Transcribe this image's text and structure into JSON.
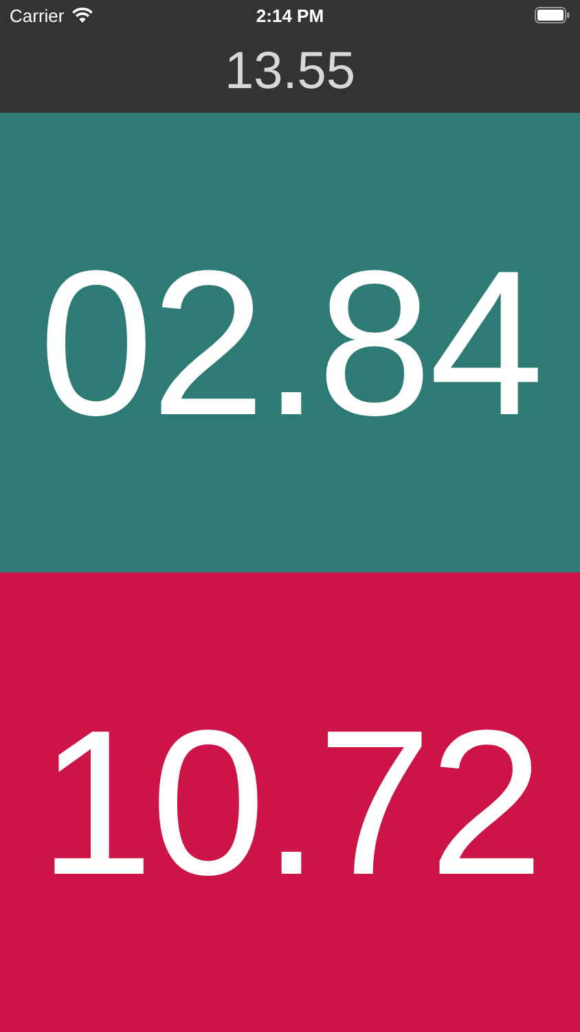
{
  "status_bar": {
    "carrier": "Carrier",
    "time": "2:14 PM"
  },
  "header": {
    "total": "13.55"
  },
  "timers": [
    {
      "value": "02.84",
      "color": "#2e7b76"
    },
    {
      "value": "10.72",
      "color": "#cc1447"
    }
  ]
}
